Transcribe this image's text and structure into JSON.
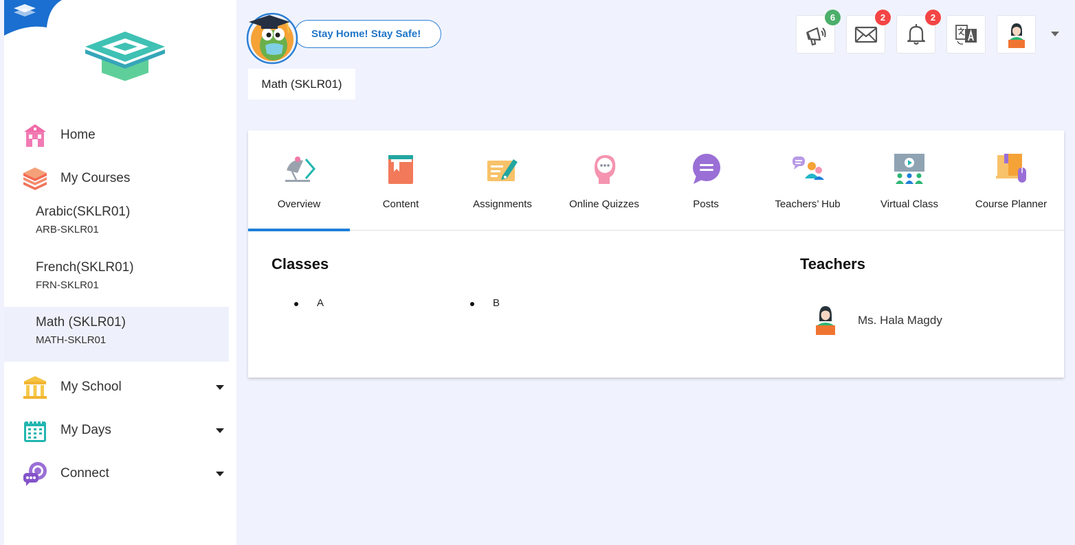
{
  "header": {
    "banner": "Stay Home! Stay Safe!",
    "current_course": "Math (SKLR01)",
    "badges": {
      "announcements": "6",
      "messages": "2",
      "notifications": "2"
    },
    "badge_colors": {
      "green": "#4caf6a",
      "red": "#f44545"
    }
  },
  "sidebar": {
    "nav": [
      {
        "label": "Home",
        "icon": "home-icon"
      },
      {
        "label": "My Courses",
        "icon": "courses-icon"
      },
      {
        "label": "My School",
        "icon": "school-icon"
      },
      {
        "label": "My Days",
        "icon": "calendar-icon"
      },
      {
        "label": "Connect",
        "icon": "connect-icon"
      }
    ],
    "courses": [
      {
        "name": "Arabic(SKLR01)",
        "code": "ARB-SKLR01"
      },
      {
        "name": "French(SKLR01)",
        "code": "FRN-SKLR01"
      },
      {
        "name": "Math (SKLR01)",
        "code": "MATH-SKLR01"
      }
    ]
  },
  "tabs": [
    {
      "label": "Overview",
      "icon": "overview-icon"
    },
    {
      "label": "Content",
      "icon": "content-icon"
    },
    {
      "label": "Assignments",
      "icon": "assignments-icon"
    },
    {
      "label": "Online Quizzes",
      "icon": "quizzes-icon"
    },
    {
      "label": "Posts",
      "icon": "posts-icon"
    },
    {
      "label": "Teachers’ Hub",
      "icon": "teachers-hub-icon"
    },
    {
      "label": "Virtual Class",
      "icon": "virtual-class-icon"
    },
    {
      "label": "Course Planner",
      "icon": "course-planner-icon"
    }
  ],
  "overview": {
    "classes_title": "Classes",
    "classes": [
      "A",
      "B"
    ],
    "teachers_title": "Teachers",
    "teachers": [
      "Ms. Hala Magdy"
    ]
  },
  "colors": {
    "accent": "#1e7fd8",
    "background": "#f0f3fd"
  }
}
